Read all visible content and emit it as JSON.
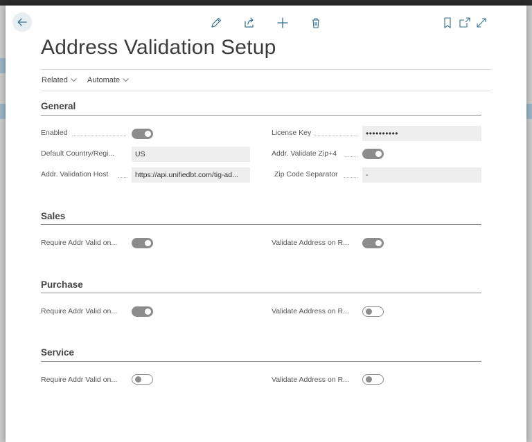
{
  "page": {
    "title": "Address Validation Setup",
    "menu": [
      {
        "label": "Related"
      },
      {
        "label": "Automate"
      }
    ]
  },
  "toolbar": {
    "icons": [
      "back-arrow-icon",
      "edit-pencil-icon",
      "share-icon",
      "new-plus-icon",
      "delete-trash-icon",
      "bookmark-icon",
      "open-new-window-icon",
      "expand-icon"
    ]
  },
  "sections": {
    "general": {
      "title": "General",
      "enabled": {
        "label": "Enabled",
        "value": true
      },
      "default_country": {
        "label": "Default Country/Regi...",
        "value": "US"
      },
      "host": {
        "label": "Addr. Validation Host",
        "value": "https://api.unifiedbt.com/tig-ad..."
      },
      "license_key": {
        "label": "License Key",
        "value": "••••••••••"
      },
      "zip4": {
        "label": "Addr. Validate Zip+4",
        "value": true
      },
      "zip_separator": {
        "label": "Zip Code Separator",
        "value": "-"
      }
    },
    "sales": {
      "title": "Sales",
      "require": {
        "label": "Require Addr Valid on...",
        "value": true
      },
      "validate": {
        "label": "Validate Address on R...",
        "value": true
      }
    },
    "purchase": {
      "title": "Purchase",
      "require": {
        "label": "Require Addr Valid on...",
        "value": true
      },
      "validate": {
        "label": "Validate Address on R...",
        "value": false
      }
    },
    "service": {
      "title": "Service",
      "require": {
        "label": "Require Addr Valid on...",
        "value": false
      },
      "validate": {
        "label": "Validate Address on R...",
        "value": false
      }
    }
  },
  "colors": {
    "toggle_on": "#8c8c8c",
    "field_bg": "#eeeeee",
    "back_button_bg": "#e6eef2",
    "icon_accent": "#2f6f8f"
  }
}
